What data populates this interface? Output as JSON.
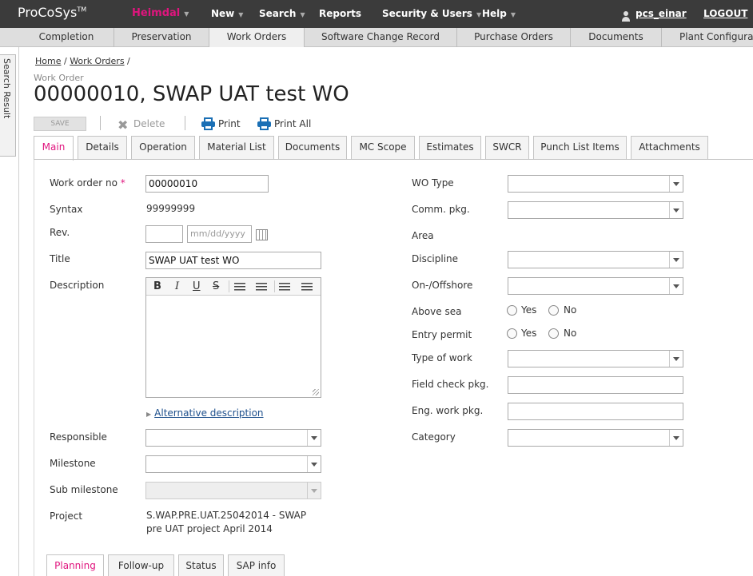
{
  "app": {
    "logo": "ProCoSys",
    "logo_tm": "TM",
    "plant": "Heimdal"
  },
  "topnav": [
    {
      "label": "New",
      "caret": true
    },
    {
      "label": "Search",
      "caret": true
    },
    {
      "label": "Reports",
      "caret": false
    },
    {
      "label": "Security & Users",
      "caret": true
    },
    {
      "label": "Help",
      "caret": true
    }
  ],
  "user": {
    "name": "pcs_einar",
    "logout": "LOGOUT"
  },
  "modules": [
    "Completion",
    "Preservation",
    "Work Orders",
    "Software Change Record",
    "Purchase Orders",
    "Documents",
    "Plant Configurati"
  ],
  "sidebar_tab": "Search Result",
  "breadcrumb": {
    "home": "Home",
    "sep": "/",
    "work_orders": "Work Orders"
  },
  "page": {
    "subtitle": "Work Order",
    "title": "00000010, SWAP UAT test WO"
  },
  "toolbar": {
    "save": "SAVE",
    "delete": "Delete",
    "print": "Print",
    "print_all": "Print All"
  },
  "tabs": [
    "Main",
    "Details",
    "Operation",
    "Material List",
    "Documents",
    "MC Scope",
    "Estimates",
    "SWCR",
    "Punch List Items",
    "Attachments"
  ],
  "form": {
    "wo_no_label": "Work order no",
    "required_mark": "*",
    "wo_no_value": "00000010",
    "syntax_label": "Syntax",
    "syntax_value": "99999999",
    "rev_label": "Rev.",
    "date_placeholder": "mm/dd/yyyy",
    "title_label": "Title",
    "title_value": "SWAP UAT test WO",
    "description_label": "Description",
    "rte_bold": "B",
    "rte_italic": "I",
    "rte_underline": "U",
    "rte_strike": "S",
    "alt_description": "Alternative description",
    "responsible_label": "Responsible",
    "milestone_label": "Milestone",
    "sub_milestone_label": "Sub milestone",
    "project_label": "Project",
    "project_line1": "S.WAP.PRE.UAT.25042014 - SWAP",
    "project_line2": "pre UAT project April 2014",
    "wo_type_label": "WO Type",
    "comm_pkg_label": "Comm. pkg.",
    "area_label": "Area",
    "discipline_label": "Discipline",
    "onoff_label": "On-/Offshore",
    "above_sea_label": "Above sea",
    "entry_permit_label": "Entry permit",
    "yes": "Yes",
    "no": "No",
    "type_of_work_label": "Type of work",
    "field_check_label": "Field check pkg.",
    "eng_work_label": "Eng. work pkg.",
    "category_label": "Category"
  },
  "bottom_tabs": [
    "Planning",
    "Follow-up",
    "Status",
    "SAP info"
  ],
  "colors": {
    "accent": "#e0157e",
    "topbar": "#3b3b3b",
    "print_icon": "#1a6fb5",
    "link": "#1d4f8c"
  }
}
